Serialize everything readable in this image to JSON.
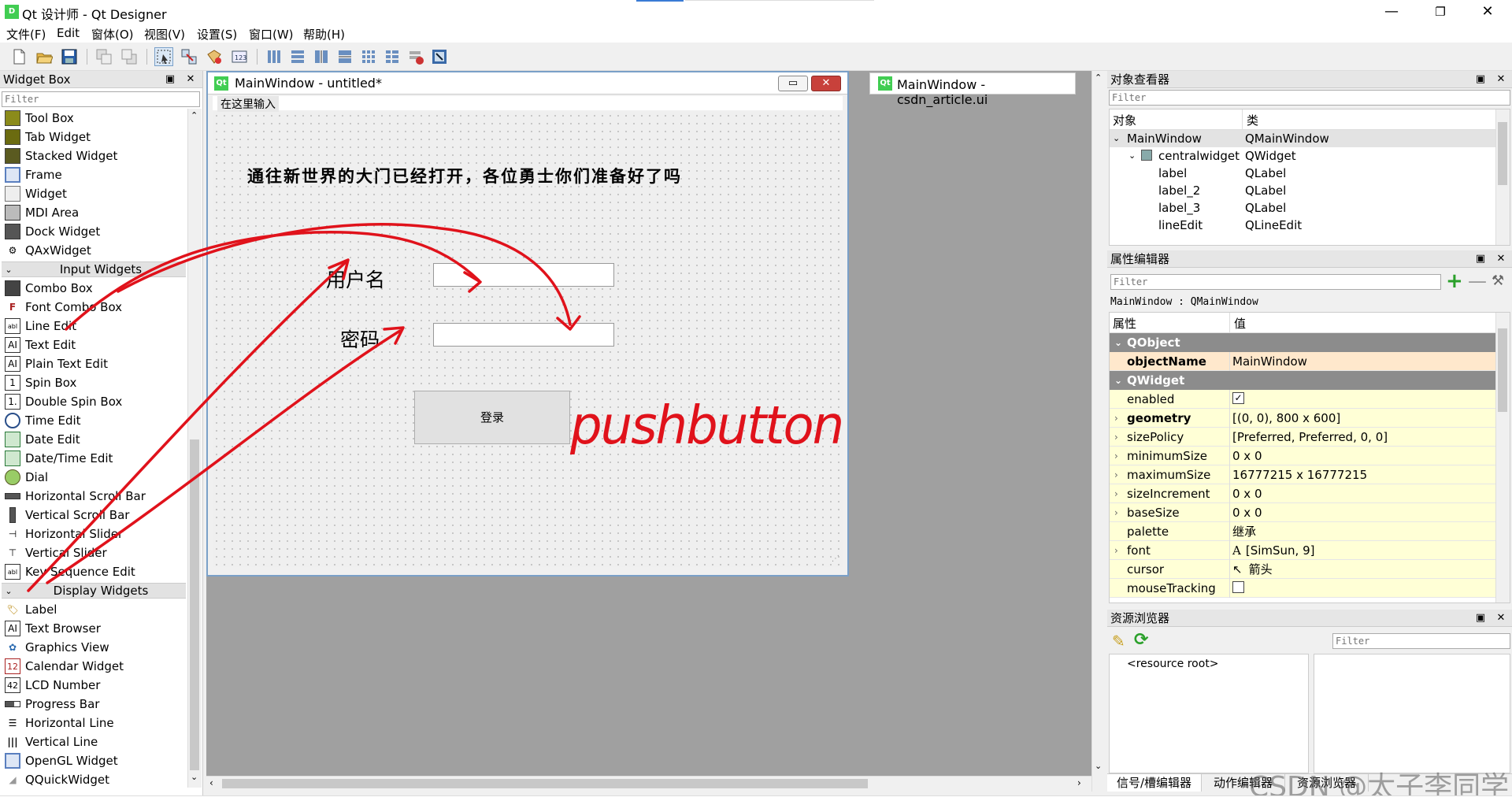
{
  "window": {
    "title": "Qt 设计师 - Qt Designer",
    "app_icon_text": "D",
    "controls": [
      "—",
      "❐",
      "✕"
    ]
  },
  "menu": [
    "文件(F)",
    "Edit",
    "窗体(O)",
    "视图(V)",
    "设置(S)",
    "窗口(W)",
    "帮助(H)"
  ],
  "widget_box": {
    "title": "Widget Box",
    "filter_placeholder": "Filter",
    "items_top": [
      "Tool Box",
      "Tab Widget",
      "Stacked Widget",
      "Frame",
      "Widget",
      "MDI Area",
      "Dock Widget",
      "QAxWidget"
    ],
    "cat_input": "Input Widgets",
    "items_input": [
      "Combo Box",
      "Font Combo Box",
      "Line Edit",
      "Text Edit",
      "Plain Text Edit",
      "Spin Box",
      "Double Spin Box",
      "Time Edit",
      "Date Edit",
      "Date/Time Edit",
      "Dial",
      "Horizontal Scroll Bar",
      "Vertical Scroll Bar",
      "Horizontal Slider",
      "Vertical Slider",
      "Key Sequence Edit"
    ],
    "cat_display": "Display Widgets",
    "items_display": [
      "Label",
      "Text Browser",
      "Graphics View",
      "Calendar Widget",
      "LCD Number",
      "Progress Bar",
      "Horizontal Line",
      "Vertical Line",
      "OpenGL Widget",
      "QQuickWidget"
    ]
  },
  "form": {
    "title": "MainWindow - untitled*",
    "menu_placeholder": "在这里输入",
    "headline": "通往新世界的大门已经打开，各位勇士你们准备好了吗",
    "label_user": "用户名",
    "label_pwd": "密码",
    "button": "登录",
    "annotation": "pushbutton"
  },
  "tab2": {
    "title": "MainWindow - csdn_article.ui"
  },
  "object_inspector": {
    "title": "对象查看器",
    "filter_placeholder": "Filter",
    "col_object": "对象",
    "col_class": "类",
    "rows": [
      {
        "name": "MainWindow",
        "cls": "QMainWindow",
        "level": 0
      },
      {
        "name": "centralwidget",
        "cls": "QWidget",
        "level": 1
      },
      {
        "name": "label",
        "cls": "QLabel",
        "level": 2
      },
      {
        "name": "label_2",
        "cls": "QLabel",
        "level": 2
      },
      {
        "name": "label_3",
        "cls": "QLabel",
        "level": 2
      },
      {
        "name": "lineEdit",
        "cls": "QLineEdit",
        "level": 2
      }
    ]
  },
  "property_editor": {
    "title": "属性编辑器",
    "filter_placeholder": "Filter",
    "context": "MainWindow : QMainWindow",
    "col_prop": "属性",
    "col_value": "值",
    "group_qobject": "QObject",
    "objectName": {
      "k": "objectName",
      "v": "MainWindow"
    },
    "group_qwidget": "QWidget",
    "rows": [
      {
        "k": "enabled",
        "v": "",
        "check": true,
        "bold": false,
        "exp": false
      },
      {
        "k": "geometry",
        "v": "[(0, 0), 800 x 600]",
        "bold": true,
        "exp": true
      },
      {
        "k": "sizePolicy",
        "v": "[Preferred, Preferred, 0, 0]",
        "bold": false,
        "exp": true
      },
      {
        "k": "minimumSize",
        "v": "0 x 0",
        "bold": false,
        "exp": true
      },
      {
        "k": "maximumSize",
        "v": "16777215 x 16777215",
        "bold": false,
        "exp": true
      },
      {
        "k": "sizeIncrement",
        "v": "0 x 0",
        "bold": false,
        "exp": true
      },
      {
        "k": "baseSize",
        "v": "0 x 0",
        "bold": false,
        "exp": true
      },
      {
        "k": "palette",
        "v": "继承",
        "bold": false,
        "exp": false
      },
      {
        "k": "font",
        "v": "[SimSun, 9]",
        "bold": false,
        "exp": true,
        "icon": "A"
      },
      {
        "k": "cursor",
        "v": "箭头",
        "bold": false,
        "exp": false,
        "icon": "↖"
      },
      {
        "k": "mouseTracking",
        "v": "",
        "check": false,
        "bold": false,
        "exp": false
      }
    ]
  },
  "resource_browser": {
    "title": "资源浏览器",
    "filter_placeholder": "Filter",
    "root": "<resource root>"
  },
  "bottom_tabs": [
    "信号/槽编辑器",
    "动作编辑器",
    "资源浏览器"
  ],
  "watermark": "CSDN @太子李同学",
  "colors": {
    "accent_blue": "#3a7bd5",
    "qt_green": "#41cd52",
    "annotation_red": "#e0121b",
    "property_yellow": "#ffffd6",
    "property_peach": "#ffe8cc"
  }
}
